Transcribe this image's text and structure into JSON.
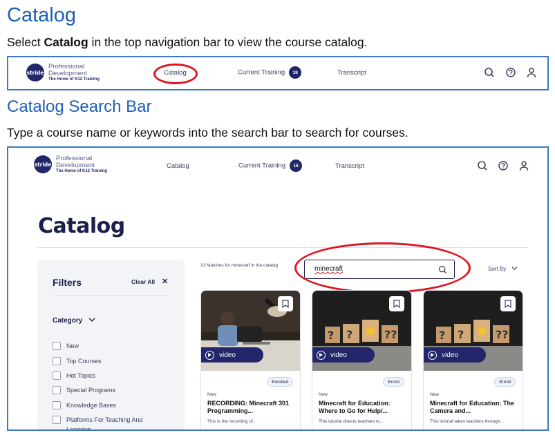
{
  "doc": {
    "heading1": "Catalog",
    "para1_prefix": "Select ",
    "para1_bold": "Catalog",
    "para1_suffix": " in the top navigation bar to view the course catalog.",
    "heading2": "Catalog Search Bar",
    "para2": "Type a course name or keywords into the search bar to search for courses."
  },
  "nav": {
    "logo_mark": "stride",
    "logo_line1": "Professional",
    "logo_line2": "Development",
    "logo_line3": "The Home of K12 Training",
    "catalog": "Catalog",
    "current_training": "Current Training",
    "current_training_count": "18",
    "transcript": "Transcript",
    "icons": [
      "search-icon",
      "help-icon",
      "user-icon"
    ]
  },
  "catalog_page": {
    "title": "Catalog",
    "filters_title": "Filters",
    "clear_all": "Clear All",
    "clear_icon": "✕",
    "category_label": "Category",
    "categories": [
      "New",
      "Top Courses",
      "Hot Topics",
      "Special Programs",
      "Knowledge Bases",
      "Platforms For Teaching And Learning"
    ],
    "matches_text": "13 Matches for minecraft in the catalog",
    "search_value": "minecraft",
    "sort_by": "Sort By",
    "cards": [
      {
        "media": "video",
        "status": "Enrolled",
        "tag": "New",
        "title": "RECORDING: Minecraft 301 Programming...",
        "desc": "This is the recording of..."
      },
      {
        "media": "video",
        "status": "Enroll",
        "tag": "New",
        "title": "Minecraft for Education: Where to Go for Help/...",
        "desc": "This tutorial directs teachers to..."
      },
      {
        "media": "video",
        "status": "Enroll",
        "tag": "New",
        "title": "Minecraft for Education: The Camera and...",
        "desc": "This tutorial takes teachers through..."
      }
    ]
  },
  "colors": {
    "heading_blue": "#1f5fb8",
    "brand_navy": "#23266a",
    "highlight_red": "#e0141e",
    "frame_blue": "#3a78c4"
  }
}
